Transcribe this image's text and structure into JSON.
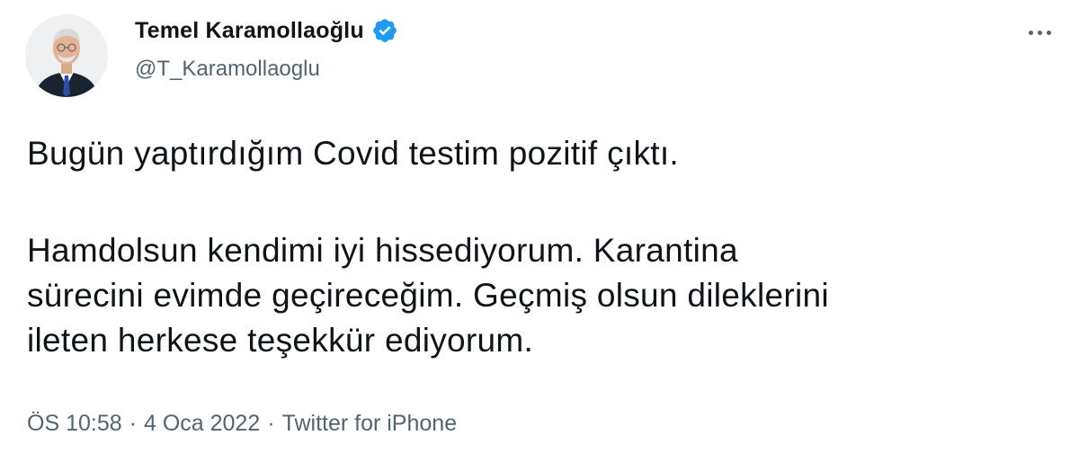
{
  "tweet": {
    "author": {
      "display_name": "Temel Karamollaoğlu",
      "handle": "@T_Karamollaoglu",
      "verified": true,
      "avatar_icon": "person-portrait-icon"
    },
    "more_icon": "more-horizontal-icon",
    "paragraphs": [
      "Bugün yaptırdığım Covid testim pozitif çıktı.",
      "Hamdolsun kendimi iyi hissediyorum. Karantina\nsürecini evimde geçireceğim. Geçmiş olsun dileklerini\nileten herkese teşekkür ediyorum."
    ],
    "meta": {
      "time": "ÖS 10:58",
      "date": "4 Oca 2022",
      "source": "Twitter for iPhone",
      "separator": "·"
    }
  },
  "colors": {
    "text": "#0f1419",
    "secondary": "#536471",
    "verified_blue": "#1d9bf0",
    "background": "#ffffff"
  }
}
